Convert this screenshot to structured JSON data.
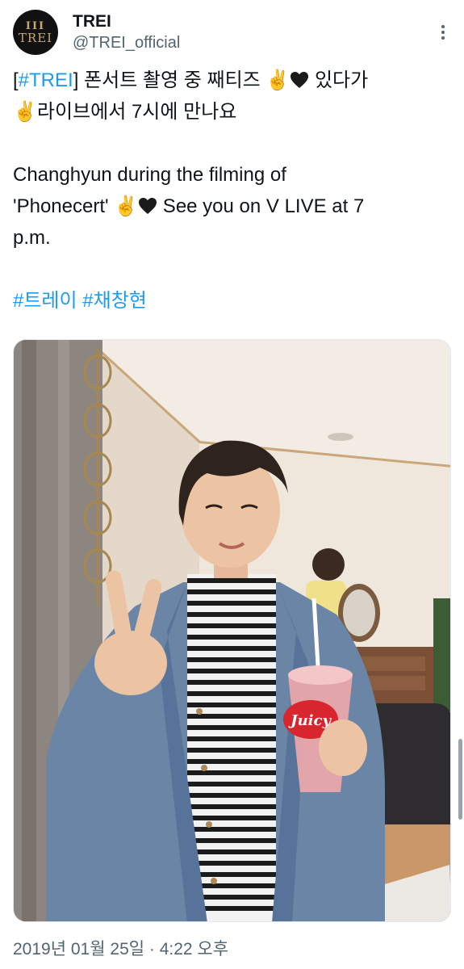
{
  "author": {
    "display_name": "TREI",
    "handle": "@TREI_official",
    "avatar_bars": "III",
    "avatar_word": "TREI"
  },
  "tweet": {
    "tag_main": "#TREI",
    "line1_prefix": "[",
    "line1_mid": "] 폰서트 촬영 중 째티즈 ",
    "line1_tail": " 있다가",
    "line2_text": "라이브에서 7시에 만나요",
    "line3_text": "Changhyun during the filming of",
    "line4_start": "'Phonecert' ",
    "line4_end": " See you on V LIVE at 7",
    "line5_text": "p.m.",
    "hashtag_1": "#트레이",
    "hashtag_2": "#채창현",
    "emoji_victory": "✌️"
  },
  "photo": {
    "cup_label": "Juicy",
    "icon": "photo-icon"
  },
  "meta": {
    "timestamp": "2019년 01월 25일 · 4:22 오후"
  },
  "colors": {
    "link": "#1d9bf0",
    "secondary": "#536471",
    "text": "#0f1419"
  }
}
